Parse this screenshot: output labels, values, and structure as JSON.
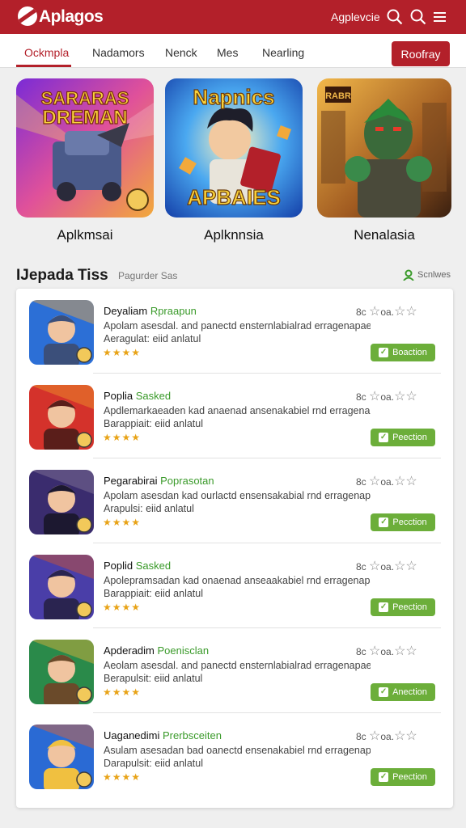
{
  "header": {
    "brand": "Aplagos",
    "link": "Agplevcie"
  },
  "tabs": [
    {
      "label": "Ockmpla"
    },
    {
      "label": "Nadamors"
    },
    {
      "label": "Nenck"
    },
    {
      "label": "Mes"
    },
    {
      "label": "Nearling"
    }
  ],
  "ready_button": "Roofray",
  "featured": [
    {
      "title": "Aplkmsai",
      "art_text_1": "SARARAS",
      "art_text_2": "DREMAN"
    },
    {
      "title": "Aplknnsia",
      "art_text_1": "Napnics",
      "art_text_2": "APBAIES"
    },
    {
      "title": "Nenalasia",
      "art_text_1": "RABR"
    }
  ],
  "section": {
    "title": "IJepada Tiss",
    "subtitle": "Pagurder Sas",
    "right_label": "Scnlwes"
  },
  "rows": [
    {
      "title": "Deyaliam",
      "accent": "Rpraapun",
      "desc": "Apolam asesdal. and panectd ensternlabialrad erragenapaei",
      "meta": "Aeragulat:  eiid anlatul",
      "stars": "★★★★",
      "rating_num": "8c",
      "rating_text": "oa.",
      "button": "Boaction",
      "colors": [
        "#2c6fd6",
        "#f2a93b",
        "#3b4f7a"
      ]
    },
    {
      "title": "Poplia",
      "accent": "Sasked",
      "desc": "Apdlemarkaeaden kad anaenad ansenakabiel rnd erragenapaei",
      "meta": "Barappiait:  eiid anlatul",
      "stars": "★★★★",
      "rating_num": "8c",
      "rating_text": "oa.",
      "button": "Peection",
      "colors": [
        "#d4322b",
        "#f09a2a",
        "#5a1e1a"
      ]
    },
    {
      "title": "Pegarabirai",
      "accent": "Poprasotan",
      "desc": "Apolam asesdan kad ourlactd ensensakabial rnd erragenapaei",
      "meta": "Arapulsi:  eiid anlatul",
      "stars": "★★★★",
      "rating_num": "8c",
      "rating_text": "oa.",
      "button": "Pecction",
      "colors": [
        "#3a2c6e",
        "#8a7a9c",
        "#1c1830"
      ]
    },
    {
      "title": "Poplid",
      "accent": "Sasked",
      "desc": "Apolepramsadan kad onaenad anseaakabiel rnd erragenapaei",
      "meta": "Barappiait:  eiid anlatul",
      "stars": "★★★★",
      "rating_num": "8c",
      "rating_text": "oa.",
      "button": "Peection",
      "colors": [
        "#4a3ea8",
        "#d4542a",
        "#2a2450"
      ]
    },
    {
      "title": "Apderadim",
      "accent": "Poenisclan",
      "desc": "Aeolam asesdal. and panectd ensternlabialrad erragenapaei",
      "meta": "Berapulsit:  eiid anlatul",
      "stars": "★★★★",
      "rating_num": "8c",
      "rating_text": "oa.",
      "button": "Anection",
      "colors": [
        "#2a8a4a",
        "#e8b43a",
        "#6a4a2a"
      ]
    },
    {
      "title": "Uaganedimi",
      "accent": "Prerbsceiten",
      "desc": "Asulam asesadan bad oanectd ensenakabiel rnd erragenapaei",
      "meta": "Darapulsit:  eiid anlatul",
      "stars": "★★★★",
      "rating_num": "8c",
      "rating_text": "oa.",
      "button": "Peection",
      "colors": [
        "#2a6ad4",
        "#e8642a",
        "#f0c040"
      ]
    }
  ]
}
